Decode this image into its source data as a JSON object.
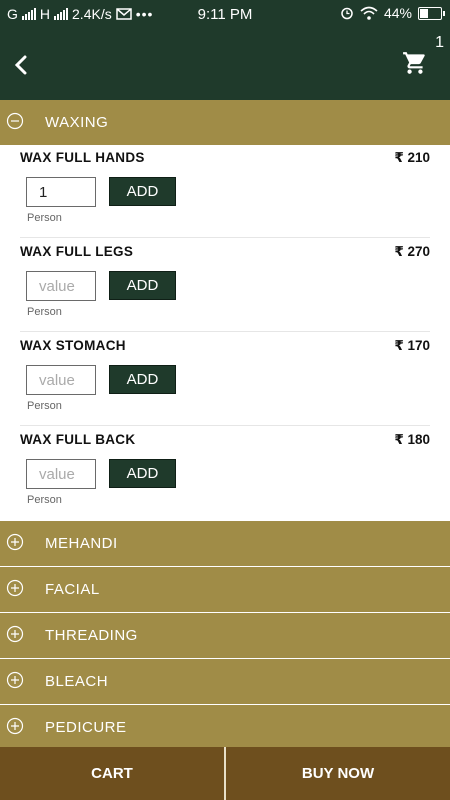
{
  "status_bar": {
    "carrier_left": "G",
    "carrier_mid": "H",
    "speed": "2.4K/s",
    "time": "9:11 PM",
    "battery": "44%",
    "battery_level": 0.44
  },
  "header": {
    "cart_count": "1"
  },
  "expanded_category": {
    "label": "WAXING",
    "items": [
      {
        "name": "WAX FULL HANDS",
        "price": "₹ 210",
        "qty_value": "1",
        "qty_placeholder": "value",
        "add_label": "ADD",
        "unit": "Person"
      },
      {
        "name": "WAX FULL LEGS",
        "price": "₹ 270",
        "qty_value": "",
        "qty_placeholder": "value",
        "add_label": "ADD",
        "unit": "Person"
      },
      {
        "name": "WAX STOMACH",
        "price": "₹ 170",
        "qty_value": "",
        "qty_placeholder": "value",
        "add_label": "ADD",
        "unit": "Person"
      },
      {
        "name": "WAX FULL BACK",
        "price": "₹ 180",
        "qty_value": "",
        "qty_placeholder": "value",
        "add_label": "ADD",
        "unit": "Person"
      }
    ]
  },
  "collapsed_categories": [
    {
      "label": "MEHANDI"
    },
    {
      "label": "FACIAL"
    },
    {
      "label": "THREADING"
    },
    {
      "label": "BLEACH"
    },
    {
      "label": "PEDICURE"
    }
  ],
  "footer": {
    "cart_label": "CART",
    "buy_label": "BUY NOW"
  },
  "colors": {
    "app_bar": "#1f3a2b",
    "category": "#a08c47",
    "footer": "#6e4f1e"
  }
}
